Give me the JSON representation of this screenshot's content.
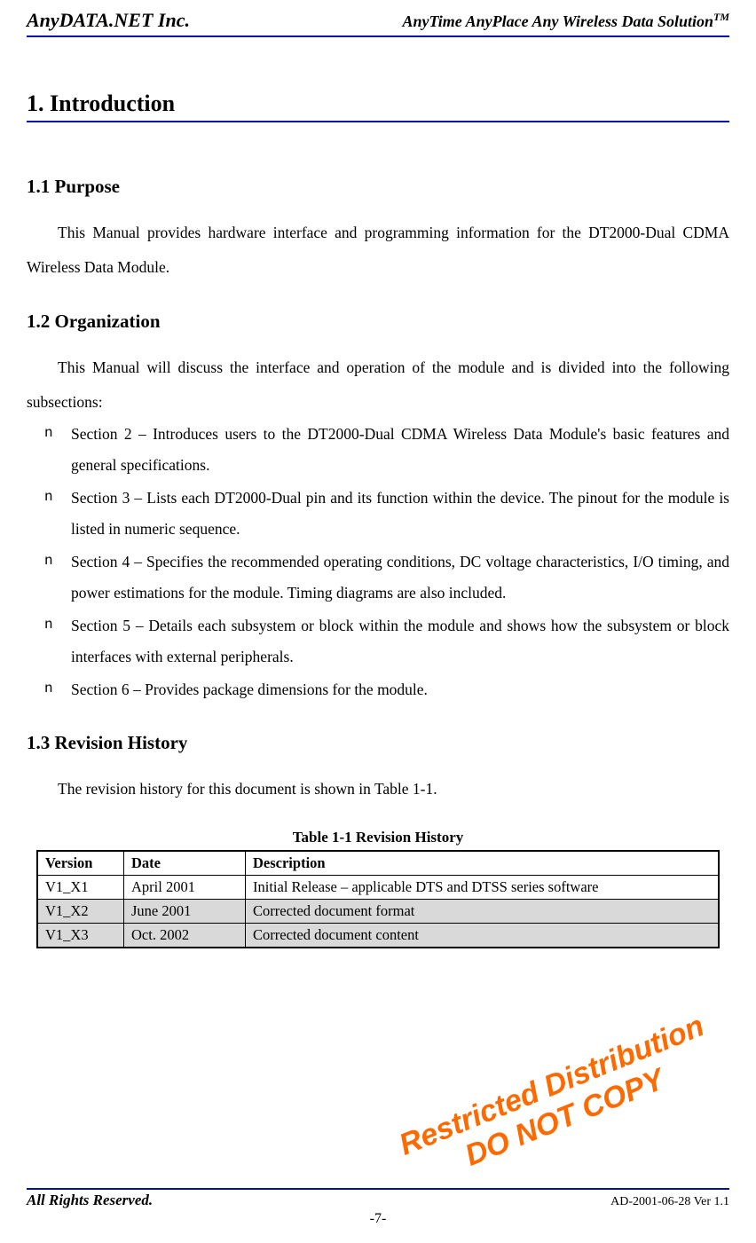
{
  "header": {
    "left": "AnyDATA.NET Inc.",
    "right_main": "AnyTime AnyPlace Any Wireless Data Solution",
    "right_sup": "TM"
  },
  "section_title": "1. Introduction",
  "s1_1": {
    "heading": "1.1 Purpose",
    "para": "This Manual provides hardware interface and programming information for the DT2000-Dual CDMA Wireless Data Module."
  },
  "s1_2": {
    "heading": "1.2 Organization",
    "para": "This Manual will discuss the interface and operation of the module and is divided into the following subsections:",
    "bullets": [
      "Section 2 – Introduces users to the DT2000-Dual CDMA Wireless Data Module's basic features and general specifications.",
      "Section 3 – Lists each DT2000-Dual pin and its function within the device. The pinout for the module is listed in numeric sequence.",
      "Section 4 – Specifies the recommended operating conditions, DC voltage characteristics, I/O timing, and power estimations for the module. Timing diagrams are also included.",
      "Section 5 – Details each subsystem or block within the module and shows how the subsystem or block interfaces with external peripherals.",
      "Section 6 – Provides package dimensions for the module."
    ]
  },
  "s1_3": {
    "heading": "1.3 Revision History",
    "para": "The revision history for this document is shown in Table 1-1.",
    "table_caption": "Table 1-1 Revision History",
    "columns": [
      "Version",
      "Date",
      "Description"
    ],
    "rows": [
      {
        "version": "V1_X1",
        "date": "April 2001",
        "desc": "Initial Release – applicable DTS and DTSS series software",
        "shaded": false
      },
      {
        "version": "V1_X2",
        "date": "June 2001",
        "desc": "Corrected document format",
        "shaded": true
      },
      {
        "version": "V1_X3",
        "date": "Oct. 2002",
        "desc": "Corrected document content",
        "shaded": true
      }
    ]
  },
  "watermark": {
    "line1": "Restricted Distribution",
    "line2": "DO NOT COPY"
  },
  "footer": {
    "left": "All Rights Reserved.",
    "right": "AD-2001-06-28 Ver 1.1",
    "center": "-7-"
  }
}
